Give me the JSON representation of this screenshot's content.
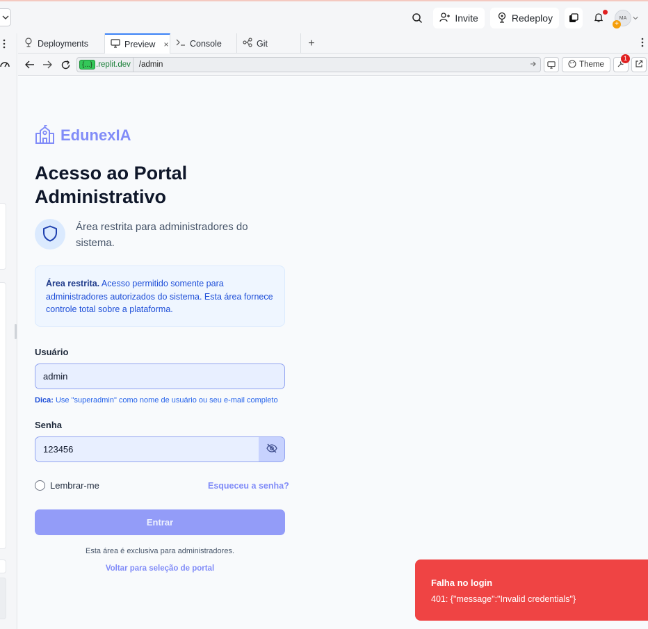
{
  "topbar": {
    "invite_label": "Invite",
    "redeploy_label": "Redeploy",
    "avatar_initials": "MA",
    "avatar_plus": "+",
    "icons": [
      "search-icon",
      "add-user-icon",
      "redeploy-icon",
      "bell-icon",
      "avatar"
    ]
  },
  "tabs": [
    {
      "label": "Deployments",
      "icon": "deployments-icon"
    },
    {
      "label": "Preview",
      "icon": "monitor-icon",
      "close": "×"
    },
    {
      "label": "Console",
      "icon": "console-icon"
    },
    {
      "label": "Git",
      "icon": "git-icon"
    }
  ],
  "tab_add": "+",
  "urlbar": {
    "badge": "{...}",
    "host": ".replit.dev",
    "path": "/admin",
    "theme_label": "Theme",
    "devtools_badge": "1"
  },
  "page": {
    "brand": "EdunexIA",
    "title": "Acesso ao Portal Administrativo",
    "subtitle": "Área restrita para administradores do sistema.",
    "notice_bold": "Área restrita.",
    "notice_text": " Acesso permitido somente para administradores autorizados do sistema. Esta área fornece controle total sobre a plataforma.",
    "username_label": "Usuário",
    "username_value": "admin",
    "hint_bold": "Dica:",
    "hint_text": " Use \"superadmin\" como nome de usuário ou seu e-mail completo",
    "password_label": "Senha",
    "password_value": "123456",
    "remember_label": "Lembrar-me",
    "forgot_label": "Esqueceu a senha?",
    "submit_label": "Entrar",
    "exclusive_text": "Esta área é exclusiva para administradores.",
    "back_label": "Voltar para seleção de portal"
  },
  "toast": {
    "title": "Falha no login",
    "message": "401: {\"message\":\"Invalid credentials\"}"
  },
  "colors": {
    "accent": "#818cf8",
    "button": "#939cf8",
    "toast": "#ef4444",
    "notice_bg": "#eff6ff"
  }
}
